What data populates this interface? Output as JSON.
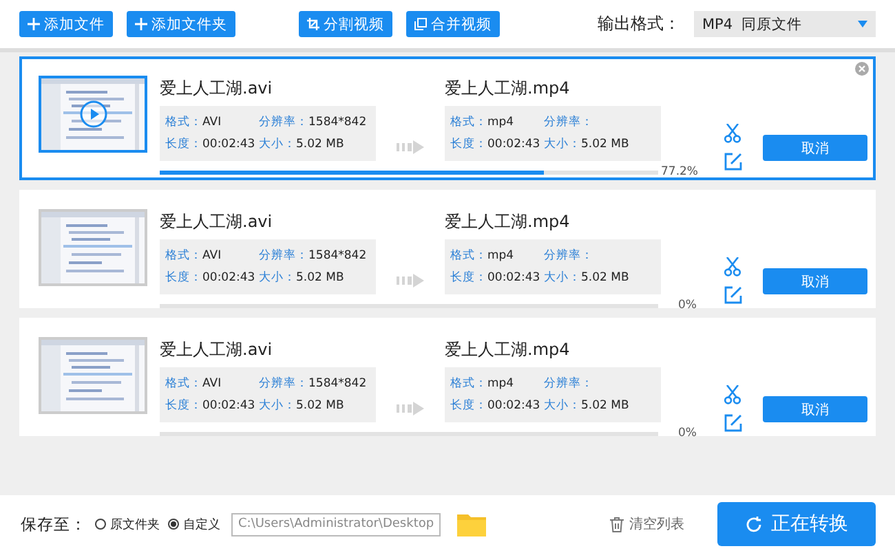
{
  "toolbar": {
    "buttons": [
      {
        "label": "添加文件",
        "kind": "plus"
      },
      {
        "label": "添加文件夹",
        "kind": "plus"
      },
      {
        "label": "分割视频",
        "kind": "crop"
      },
      {
        "label": "合并视频",
        "kind": "merge"
      }
    ],
    "output_format": {
      "label": "输出格式：",
      "value": "MP4  同原文件"
    }
  },
  "tasks": [
    {
      "selected": true,
      "source": {
        "name": "爱上人工湖.avi",
        "fields": [
          {
            "label": "格式：",
            "value": "AVI"
          },
          {
            "label": "分辨率：",
            "value": "1584*842"
          },
          {
            "label": "长度：",
            "value": "00:02:43"
          },
          {
            "label": "大小：",
            "value": "5.02 MB"
          }
        ]
      },
      "target": {
        "name": "爱上人工湖.mp4",
        "fields": [
          {
            "label": "格式：",
            "value": "mp4"
          },
          {
            "label": "分辨率："
          },
          {
            "label": "长度：",
            "value": "00:02:43"
          },
          {
            "label": "大小：",
            "value": "5.02 MB"
          }
        ]
      },
      "level": 0.772,
      "percent": "77.2%",
      "cancel": "取消"
    },
    {
      "selected": false,
      "source": {
        "name": "爱上人工湖.avi",
        "fields": [
          {
            "label": "格式：",
            "value": "AVI"
          },
          {
            "label": "分辨率：",
            "value": "1584*842"
          },
          {
            "label": "长度：",
            "value": "00:02:43"
          },
          {
            "label": "大小：",
            "value": "5.02 MB"
          }
        ]
      },
      "target": {
        "name": "爱上人工湖.mp4",
        "fields": [
          {
            "label": "格式：",
            "value": "mp4"
          },
          {
            "label": "分辨率："
          },
          {
            "label": "长度：",
            "value": "00:02:43"
          },
          {
            "label": "大小：",
            "value": "5.02 MB"
          }
        ]
      },
      "percent": "0%",
      "cancel": "取消"
    },
    {
      "selected": false,
      "source": {
        "name": "爱上人工湖.avi",
        "fields": [
          {
            "label": "格式：",
            "value": "AVI"
          },
          {
            "label": "分辨率：",
            "value": "1584*842"
          },
          {
            "label": "长度：",
            "value": "00:02:43"
          },
          {
            "label": "大小：",
            "value": "5.02 MB"
          }
        ]
      },
      "target": {
        "name": "爱上人工湖.mp4",
        "fields": [
          {
            "label": "格式：",
            "value": "mp4"
          },
          {
            "label": "分辨率："
          },
          {
            "label": "长度：",
            "value": "00:02:43"
          },
          {
            "label": "大小：",
            "value": "5.02 MB"
          }
        ]
      },
      "percent": "0%",
      "cancel": "取消"
    }
  ],
  "footer": {
    "save_label": "保存至：",
    "options": [
      {
        "label": "原文件夹",
        "selected": false
      },
      {
        "label": "自定义",
        "selected": true
      }
    ],
    "path": "C:\\Users\\Administrator\\Desktop",
    "clear": "清空列表",
    "convert": "正在转换"
  }
}
